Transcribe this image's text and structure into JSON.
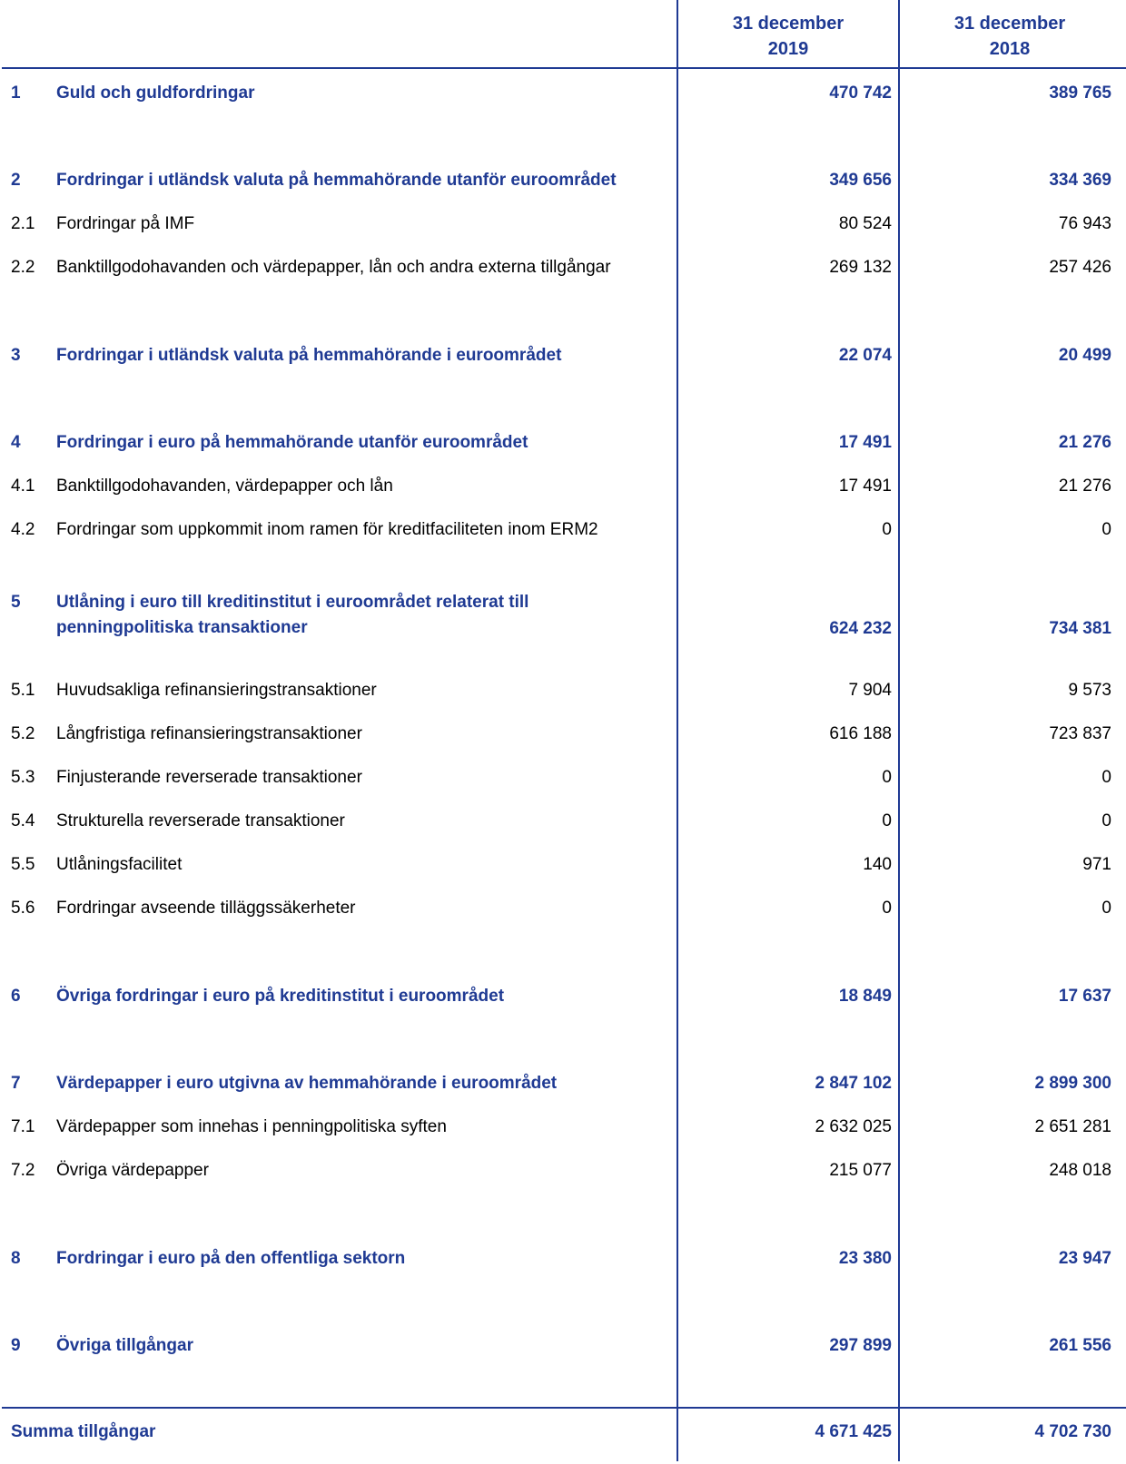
{
  "header": {
    "col1": [
      "31 december",
      "2019"
    ],
    "col2": [
      "31 december",
      "2018"
    ]
  },
  "rows": [
    {
      "num": "1",
      "label": "Guld och guldfordringar",
      "v2019": "470 742",
      "v2018": "389 765",
      "bold": true
    },
    {
      "num": "2",
      "label": "Fordringar i utländsk valuta på hemmahörande utanför euroområdet",
      "v2019": "349 656",
      "v2018": "334 369",
      "bold": true
    },
    {
      "num": "2.1",
      "label": "Fordringar på IMF",
      "v2019": "80 524",
      "v2018": "76 943",
      "bold": false
    },
    {
      "num": "2.2",
      "label": "Banktillgodohavanden och värdepapper, lån och andra externa tillgångar",
      "v2019": "269 132",
      "v2018": "257 426",
      "bold": false
    },
    {
      "num": "3",
      "label": "Fordringar i utländsk valuta på hemmahörande i euroområdet",
      "v2019": "22 074",
      "v2018": "20 499",
      "bold": true
    },
    {
      "num": "4",
      "label": "Fordringar i euro på hemmahörande utanför euroområdet",
      "v2019": "17 491",
      "v2018": "21 276",
      "bold": true
    },
    {
      "num": "4.1",
      "label": "Banktillgodohavanden, värdepapper och lån",
      "v2019": "17 491",
      "v2018": "21 276",
      "bold": false
    },
    {
      "num": "4.2",
      "label": "Fordringar som uppkommit inom ramen för kreditfaciliteten inom ERM2",
      "v2019": "0",
      "v2018": "0",
      "bold": false
    },
    {
      "num": "5",
      "label": [
        "Utlåning i euro till kreditinstitut i euroområdet relaterat till",
        "penningpolitiska transaktioner"
      ],
      "v2019": "624 232",
      "v2018": "734 381",
      "bold": true
    },
    {
      "num": "5.1",
      "label": "Huvudsakliga refinansieringstransaktioner",
      "v2019": "7 904",
      "v2018": "9 573",
      "bold": false
    },
    {
      "num": "5.2",
      "label": "Långfristiga refinansieringstransaktioner",
      "v2019": "616 188",
      "v2018": "723 837",
      "bold": false
    },
    {
      "num": "5.3",
      "label": "Finjusterande reverserade transaktioner",
      "v2019": "0",
      "v2018": "0",
      "bold": false
    },
    {
      "num": "5.4",
      "label": "Strukturella reverserade transaktioner",
      "v2019": "0",
      "v2018": "0",
      "bold": false
    },
    {
      "num": "5.5",
      "label": "Utlåningsfacilitet",
      "v2019": "140",
      "v2018": "971",
      "bold": false
    },
    {
      "num": "5.6",
      "label": "Fordringar avseende tilläggssäkerheter",
      "v2019": "0",
      "v2018": "0",
      "bold": false
    },
    {
      "num": "6",
      "label": "Övriga fordringar i euro på kreditinstitut i euroområdet",
      "v2019": "18 849",
      "v2018": "17 637",
      "bold": true
    },
    {
      "num": "7",
      "label": "Värdepapper i euro utgivna av hemmahörande i euroområdet",
      "v2019": "2 847 102",
      "v2018": "2 899 300",
      "bold": true
    },
    {
      "num": "7.1",
      "label": "Värdepapper som innehas i penningpolitiska syften",
      "v2019": "2 632 025",
      "v2018": "2 651 281",
      "bold": false
    },
    {
      "num": "7.2",
      "label": "Övriga värdepapper",
      "v2019": "215 077",
      "v2018": "248 018",
      "bold": false
    },
    {
      "num": "8",
      "label": "Fordringar i euro på den offentliga sektorn",
      "v2019": "23 380",
      "v2018": "23 947",
      "bold": true
    },
    {
      "num": "9",
      "label": "Övriga tillgångar",
      "v2019": "297 899",
      "v2018": "261 556",
      "bold": true
    }
  ],
  "total": {
    "label": "Summa tillgångar",
    "v2019": "4 671 425",
    "v2018": "4 702 730"
  }
}
